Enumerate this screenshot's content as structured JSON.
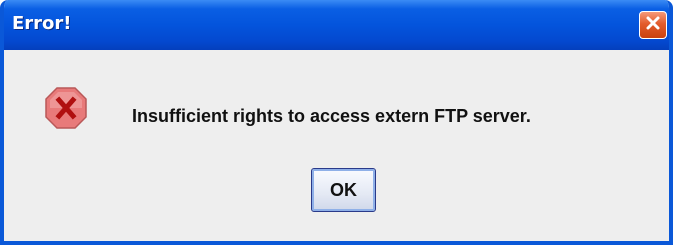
{
  "dialog": {
    "title": "Error!",
    "message": "Insufficient rights to access extern FTP server.",
    "icon": "error-icon",
    "ok_label": "OK",
    "close_icon": "close-icon"
  },
  "colors": {
    "titlebar": "#0454dc",
    "close_button": "#e35c2c",
    "error_icon_fill": "#e87a7a",
    "error_icon_mark": "#b01010",
    "background": "#eeeeee"
  }
}
